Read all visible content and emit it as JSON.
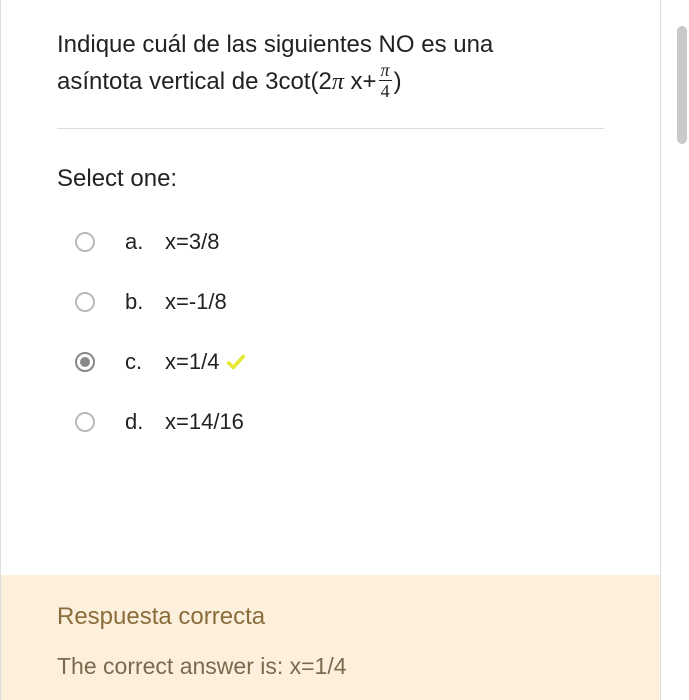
{
  "question": {
    "line1": "Indique cuál de las siguientes NO es una",
    "line2_prefix": "asíntota vertical de 3cot(2",
    "line2_mid": " x+",
    "line2_suffix": ")",
    "frac_num": "π",
    "frac_den": "4"
  },
  "select_label": "Select one:",
  "options": [
    {
      "letter": "a.",
      "text": "x=3/8",
      "selected": false,
      "correct": false
    },
    {
      "letter": "b.",
      "text": "x=-1/8",
      "selected": false,
      "correct": false
    },
    {
      "letter": "c.",
      "text": "x=1/4",
      "selected": true,
      "correct": true
    },
    {
      "letter": "d.",
      "text": "x=14/16",
      "selected": false,
      "correct": false
    }
  ],
  "feedback": {
    "title": "Respuesta correcta",
    "answer": "The correct answer is: x=1/4"
  }
}
